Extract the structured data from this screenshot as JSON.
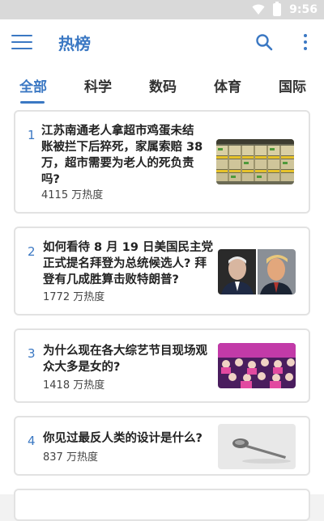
{
  "status": {
    "time": "9:56"
  },
  "appbar": {
    "title": "热榜"
  },
  "tabs": [
    {
      "label": "全部"
    },
    {
      "label": "科学"
    },
    {
      "label": "数码"
    },
    {
      "label": "体育"
    },
    {
      "label": "国际"
    }
  ],
  "feed": [
    {
      "rank": "1",
      "title": "江苏南通老人拿超市鸡蛋未结账被拦下后猝死，家属索赔 38 万，超市需要为老人的死负责吗?",
      "title_lines": [
        "江苏南通老人拿超市鸡蛋未结",
        "账被拦下后猝死，家属索赔 38",
        "万，超市需要为老人的死负责",
        "吗?"
      ],
      "heat": "4115 万热度",
      "image": "egg-shelves-image"
    },
    {
      "rank": "2",
      "title": "如何看待 8 月 19 日美国民主党正式提名拜登为总统候选人? 拜登有几成胜算击败特朗普?",
      "title_lines": [
        "如何看待 8 月 19 日美国民主党",
        "正式提名拜登为总统候选人? 拜",
        "登有几成胜算击败特朗普?"
      ],
      "heat": "1772 万热度",
      "image": "two-politicians-image"
    },
    {
      "rank": "3",
      "title": "为什么现在各大综艺节目现场观众大多是女的?",
      "title_lines": [
        "为什么现在各大综艺节目现场观",
        "众大多是女的?"
      ],
      "heat": "1418 万热度",
      "image": "audience-image"
    },
    {
      "rank": "4",
      "title": "你见过最反人类的设计是什么?",
      "title_lines": [
        "你见过最反人类的设计是什么?"
      ],
      "heat": "837 万热度",
      "image": "spoon-image"
    }
  ]
}
